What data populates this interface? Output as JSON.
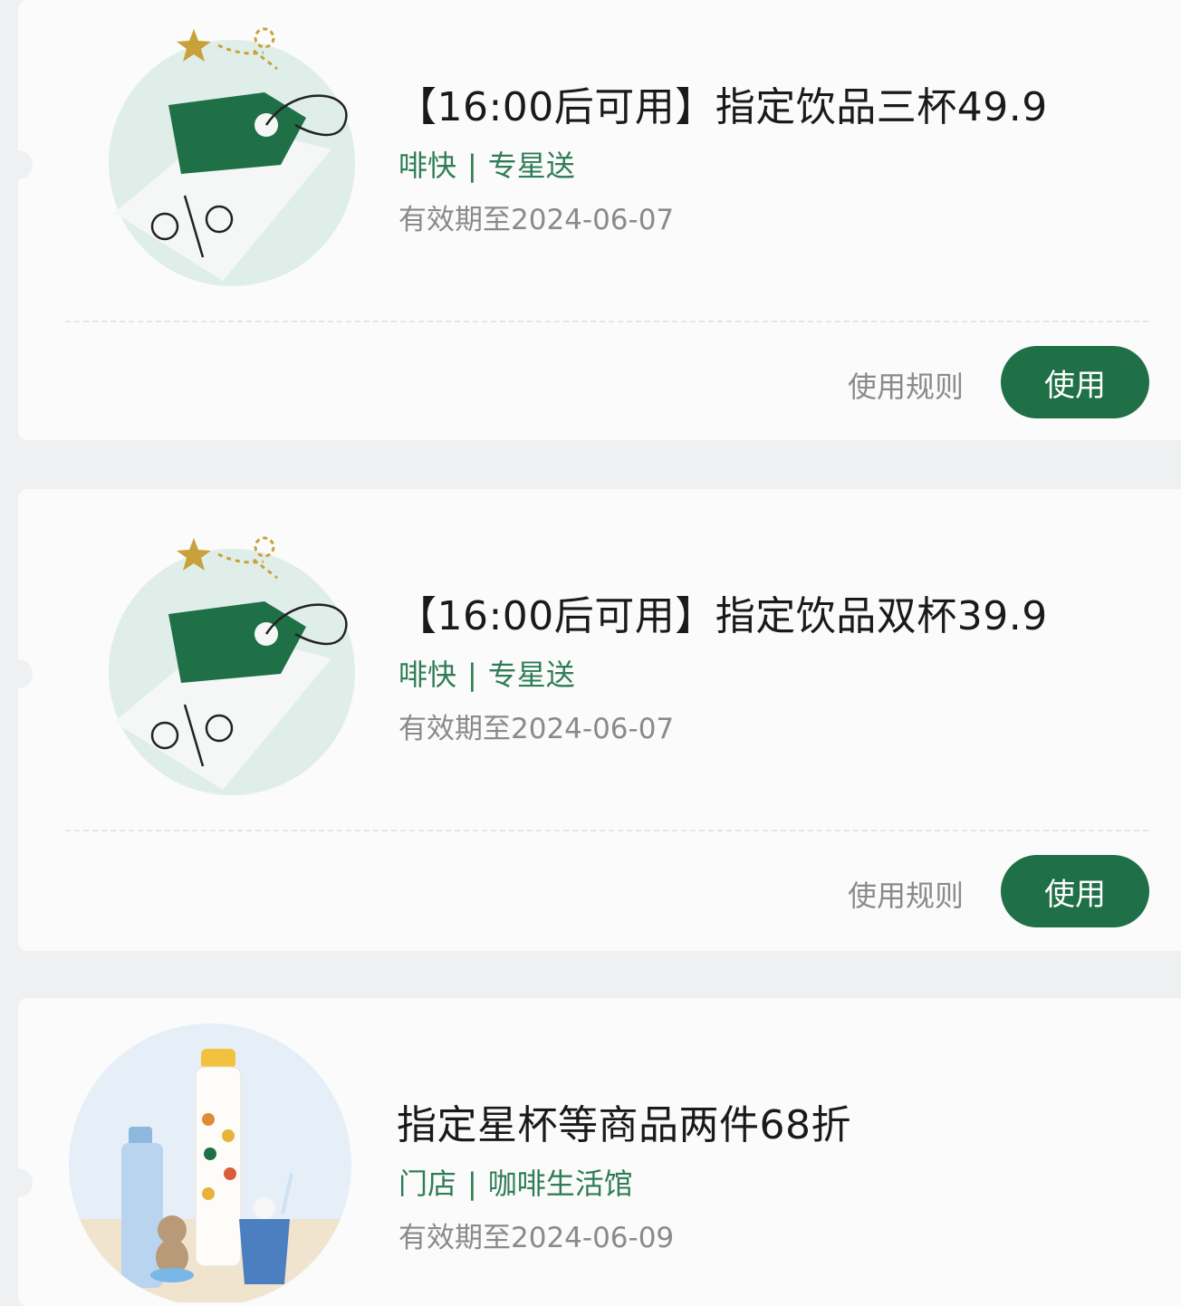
{
  "coupons": [
    {
      "title": "【16:00后可用】指定饮品三杯49.9",
      "channel_a": "啡快",
      "separator": "|",
      "channel_b": "专星送",
      "expiry": "有效期至2024-06-07",
      "rules_label": "使用规则",
      "use_label": "使用",
      "art_icon": "discount-tag-icon"
    },
    {
      "title": "【16:00后可用】指定饮品双杯39.9",
      "channel_a": "啡快",
      "separator": "|",
      "channel_b": "专星送",
      "expiry": "有效期至2024-06-07",
      "rules_label": "使用规则",
      "use_label": "使用",
      "art_icon": "discount-tag-icon"
    },
    {
      "title": "指定星杯等商品两件68折",
      "channel_a": "门店",
      "separator": "|",
      "channel_b": "咖啡生活馆",
      "expiry": "有效期至2024-06-09",
      "art_icon": "merchandise-tumblers-image"
    }
  ],
  "colors": {
    "brand_green": "#1f6f47",
    "channel_green": "#2f7d56",
    "page_background": "#eef0f2",
    "card_background": "#fbfbfb",
    "muted_text": "#8a8a8a",
    "star_gold": "#c9a13b"
  }
}
